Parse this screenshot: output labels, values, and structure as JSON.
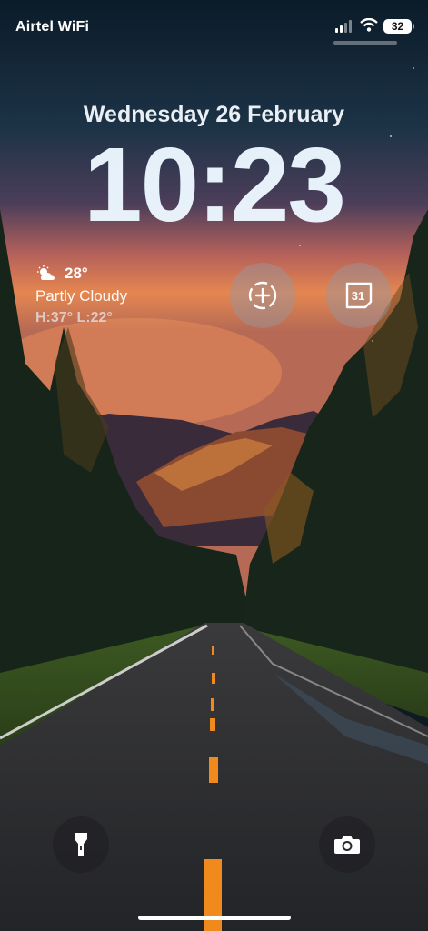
{
  "status_bar": {
    "carrier": "Airtel WiFi",
    "signal_icon": "signal-bars-icon",
    "wifi_icon": "wifi-icon",
    "battery_level": "32"
  },
  "lock_screen": {
    "date": "Wednesday 26 February",
    "time": "10:23"
  },
  "weather": {
    "icon": "partly-cloudy-icon",
    "temperature": "28°",
    "condition": "Partly Cloudy",
    "high_low": "H:37° L:22°"
  },
  "widgets": {
    "add_widget_icon": "dashed-circle-plus-icon",
    "calendar_day": "31"
  },
  "quick_actions": {
    "flashlight_icon": "flashlight-icon",
    "camera_icon": "camera-icon"
  },
  "colors": {
    "sky_top": "#0d1d2b",
    "sunset": "#e07a4a",
    "forest": "#1e2d1a",
    "road": "#2b2d30",
    "lane_marking": "#f08a1c"
  }
}
